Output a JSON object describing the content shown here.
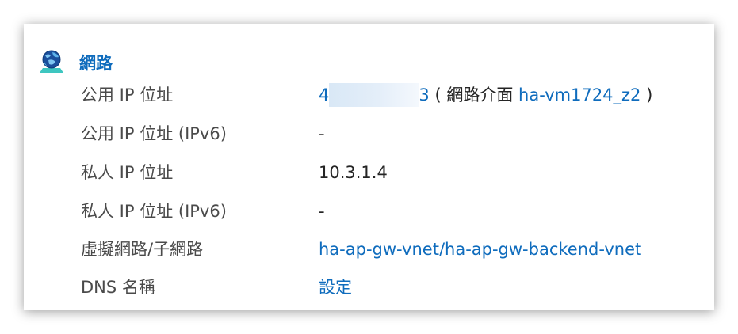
{
  "section": {
    "title": "網路",
    "icon": "network-globe-icon"
  },
  "rows": {
    "public_ip": {
      "label": "公用 IP 位址",
      "value_prefix": "4",
      "value_suffix": "3",
      "open_paren": "(",
      "nic_text": "網路介面",
      "nic_link": "ha-vm1724_z2",
      "close_paren": ")"
    },
    "public_ipv6": {
      "label": "公用 IP 位址 (IPv6)",
      "value": "-"
    },
    "private_ip": {
      "label": "私人 IP 位址",
      "value": "10.3.1.4"
    },
    "private_ipv6": {
      "label": "私人 IP 位址 (IPv6)",
      "value": "-"
    },
    "vnet": {
      "label": "虛擬網路/子網路",
      "value": "ha-ap-gw-vnet/ha-ap-gw-backend-vnet"
    },
    "dns": {
      "label": "DNS 名稱",
      "value": "設定"
    }
  },
  "colors": {
    "link": "#0f6cbd",
    "label": "#4a4a4a",
    "value": "#242424"
  }
}
